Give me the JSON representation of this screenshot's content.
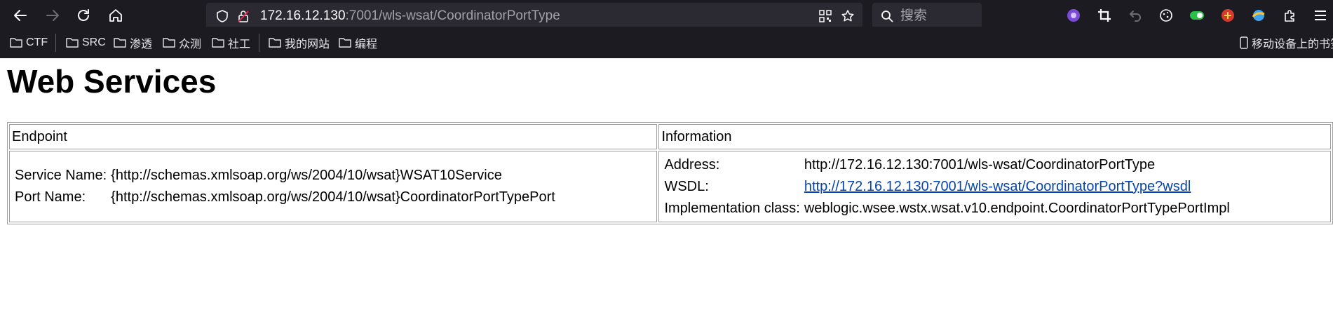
{
  "browser": {
    "url_host": "172.16.12.130",
    "url_path": ":7001/wls-wsat/CoordinatorPortType",
    "search_placeholder": "搜索",
    "bookmarks": [
      "CTF",
      "SRC",
      "渗透",
      "众测",
      "社工",
      "我的网站",
      "编程"
    ],
    "mobile_bookmarks": "移动设备上的书签"
  },
  "page": {
    "title": "Web Services",
    "headers": {
      "endpoint": "Endpoint",
      "information": "Information"
    },
    "endpoint": {
      "service_label": "Service Name:",
      "service_value": "{http://schemas.xmlsoap.org/ws/2004/10/wsat}WSAT10Service",
      "port_label": "Port Name:",
      "port_value": "{http://schemas.xmlsoap.org/ws/2004/10/wsat}CoordinatorPortTypePort"
    },
    "information": {
      "address_label": "Address:",
      "address_value": "http://172.16.12.130:7001/wls-wsat/CoordinatorPortType",
      "wsdl_label": "WSDL:",
      "wsdl_value": "http://172.16.12.130:7001/wls-wsat/CoordinatorPortType?wsdl",
      "impl_label": "Implementation class:",
      "impl_value": "weblogic.wsee.wstx.wsat.v10.endpoint.CoordinatorPortTypePortImpl"
    }
  }
}
